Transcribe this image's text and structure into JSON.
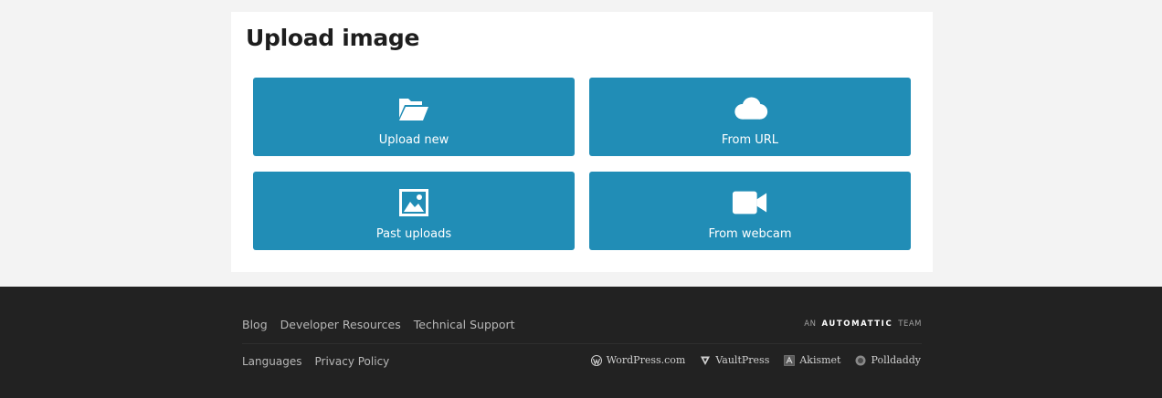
{
  "page": {
    "title": "Upload image"
  },
  "tiles": [
    {
      "label": "Upload new",
      "icon": "folder-open-icon"
    },
    {
      "label": "From URL",
      "icon": "cloud-icon"
    },
    {
      "label": "Past uploads",
      "icon": "image-icon"
    },
    {
      "label": "From webcam",
      "icon": "video-camera-icon"
    }
  ],
  "footer": {
    "links_row1": [
      "Blog",
      "Developer Resources",
      "Technical Support"
    ],
    "links_row2": [
      "Languages",
      "Privacy Policy"
    ],
    "automattic": {
      "prefix": "AN",
      "brand": "AUTOMATTIC",
      "suffix": "TEAM"
    },
    "products": [
      {
        "label": "WordPress.com",
        "icon": "wordpress-icon"
      },
      {
        "label": "VaultPress",
        "icon": "vaultpress-icon"
      },
      {
        "label": "Akismet",
        "icon": "akismet-icon"
      },
      {
        "label": "Polldaddy",
        "icon": "polldaddy-icon"
      }
    ]
  },
  "colors": {
    "tile_background": "#218db6",
    "page_background": "#f3f3f3",
    "footer_background": "#222222"
  }
}
